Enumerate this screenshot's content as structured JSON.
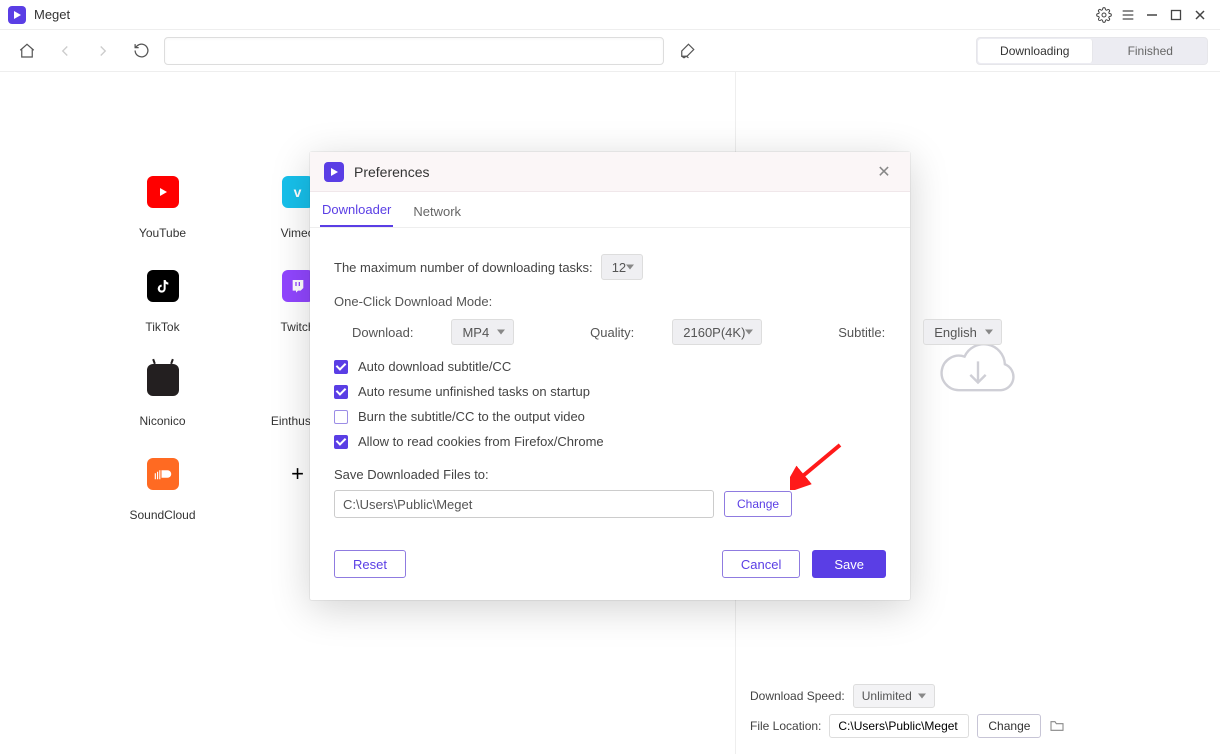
{
  "app": {
    "name": "Meget"
  },
  "toolbar": {
    "url": ""
  },
  "panel_tabs": {
    "downloading": "Downloading",
    "finished": "Finished",
    "active": "downloading"
  },
  "sites": [
    {
      "name": "YouTube"
    },
    {
      "name": "Vimeo"
    },
    {
      "name": "TikTok"
    },
    {
      "name": "Twitch"
    },
    {
      "name": "Niconico"
    },
    {
      "name": "Einthusan"
    },
    {
      "name": "SoundCloud"
    }
  ],
  "right_footer": {
    "speed_label": "Download Speed:",
    "speed_value": "Unlimited",
    "location_label": "File Location:",
    "location_value": "C:\\Users\\Public\\Meget",
    "change": "Change"
  },
  "prefs": {
    "title": "Preferences",
    "tabs": {
      "downloader": "Downloader",
      "network": "Network",
      "active": "downloader"
    },
    "max_tasks_label": "The maximum number of downloading tasks:",
    "max_tasks_value": "12",
    "oneclick_header": "One-Click Download Mode:",
    "download_label": "Download:",
    "download_value": "MP4",
    "quality_label": "Quality:",
    "quality_value": "2160P(4K)",
    "subtitle_label": "Subtitle:",
    "subtitle_value": "English",
    "checks": {
      "auto_subtitle": {
        "label": "Auto download subtitle/CC",
        "checked": true
      },
      "auto_resume": {
        "label": "Auto resume unfinished tasks on startup",
        "checked": true
      },
      "burn": {
        "label": "Burn the subtitle/CC to the output video",
        "checked": false
      },
      "cookies": {
        "label": "Allow to read cookies from Firefox/Chrome",
        "checked": true
      }
    },
    "save_label": "Save Downloaded Files to:",
    "save_path": "C:\\Users\\Public\\Meget",
    "change": "Change",
    "reset": "Reset",
    "cancel": "Cancel",
    "save": "Save"
  }
}
